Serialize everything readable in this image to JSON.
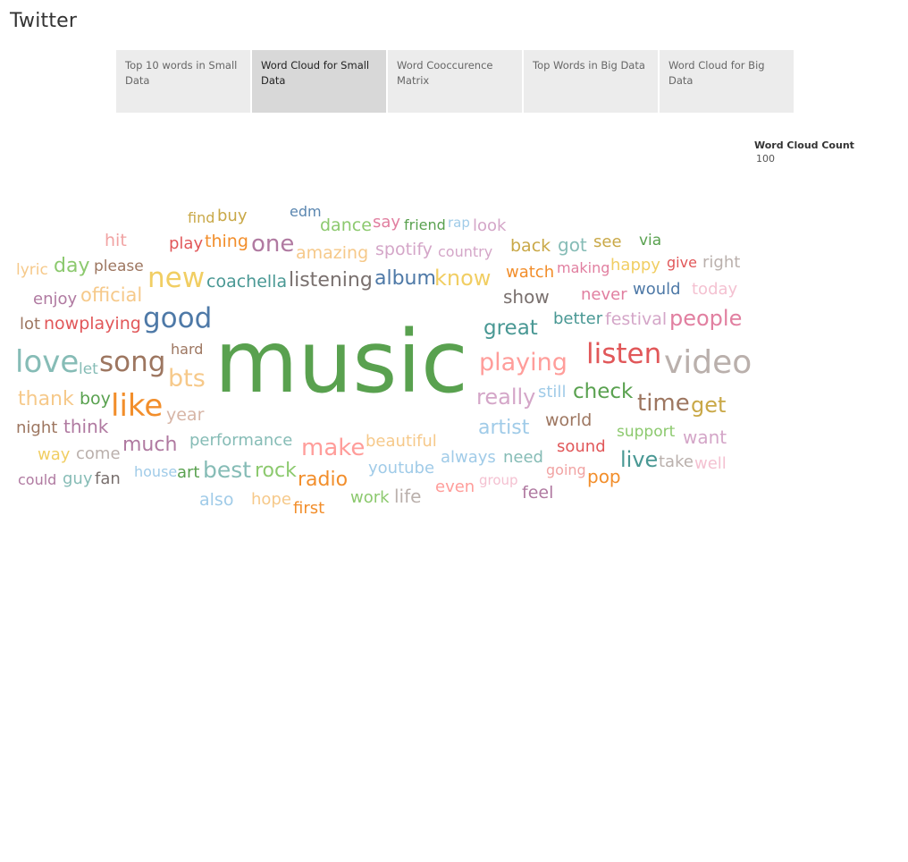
{
  "title": "Twitter",
  "tabs": [
    {
      "label": "Top 10 words in Small Data",
      "active": false
    },
    {
      "label": "Word Cloud for Small Data",
      "active": true
    },
    {
      "label": "Word Cooccurence Matrix",
      "active": false
    },
    {
      "label": "Top Words in Big Data",
      "active": false
    },
    {
      "label": "Word Cloud for Big Data",
      "active": false
    }
  ],
  "legend": {
    "title": "Word Cloud Count",
    "value": "100"
  },
  "words": [
    {
      "text": "find",
      "color": "#c9a847"
    },
    {
      "text": "buy",
      "color": "#c9a847"
    },
    {
      "text": "edm",
      "color": "#5a86b0"
    },
    {
      "text": "dance",
      "color": "#8cc96e"
    },
    {
      "text": "say",
      "color": "#e17fa0"
    },
    {
      "text": "friend",
      "color": "#59a14f"
    },
    {
      "text": "rap",
      "color": "#a0cbe8"
    },
    {
      "text": "look",
      "color": "#d4a6c8"
    },
    {
      "text": "hit",
      "color": "#f1a3a3"
    },
    {
      "text": "play",
      "color": "#e15759"
    },
    {
      "text": "thing",
      "color": "#f28e2b"
    },
    {
      "text": "one",
      "color": "#b07aa1"
    },
    {
      "text": "amazing",
      "color": "#f6c98a"
    },
    {
      "text": "spotify",
      "color": "#d4a6c8"
    },
    {
      "text": "country",
      "color": "#d4a6c8"
    },
    {
      "text": "back",
      "color": "#c9a847"
    },
    {
      "text": "got",
      "color": "#86bcb6"
    },
    {
      "text": "see",
      "color": "#c9a847"
    },
    {
      "text": "via",
      "color": "#59a14f"
    },
    {
      "text": "lyric",
      "color": "#f6c98a"
    },
    {
      "text": "day",
      "color": "#8cc96e"
    },
    {
      "text": "please",
      "color": "#9d7660"
    },
    {
      "text": "new",
      "color": "#f1ce63"
    },
    {
      "text": "coachella",
      "color": "#499894"
    },
    {
      "text": "listening",
      "color": "#79706e"
    },
    {
      "text": "album",
      "color": "#4e79a7"
    },
    {
      "text": "know",
      "color": "#f1ce63"
    },
    {
      "text": "watch",
      "color": "#f28e2b"
    },
    {
      "text": "making",
      "color": "#e17fa0"
    },
    {
      "text": "happy",
      "color": "#f1ce63"
    },
    {
      "text": "give",
      "color": "#e15759"
    },
    {
      "text": "right",
      "color": "#bab0ac"
    },
    {
      "text": "enjoy",
      "color": "#b07aa1"
    },
    {
      "text": "official",
      "color": "#f6c98a"
    },
    {
      "text": "show",
      "color": "#79706e"
    },
    {
      "text": "never",
      "color": "#e17fa0"
    },
    {
      "text": "would",
      "color": "#4e79a7"
    },
    {
      "text": "today",
      "color": "#f4c1d1"
    },
    {
      "text": "lot",
      "color": "#9d7660"
    },
    {
      "text": "nowplaying",
      "color": "#e15759"
    },
    {
      "text": "good",
      "color": "#4e79a7"
    },
    {
      "text": "great",
      "color": "#499894"
    },
    {
      "text": "better",
      "color": "#499894"
    },
    {
      "text": "festival",
      "color": "#d4a6c8"
    },
    {
      "text": "people",
      "color": "#e17fa0"
    },
    {
      "text": "hard",
      "color": "#9d7660"
    },
    {
      "text": "love",
      "color": "#86bcb6"
    },
    {
      "text": "let",
      "color": "#86bcb6"
    },
    {
      "text": "song",
      "color": "#9d7660"
    },
    {
      "text": "music",
      "color": "#59a14f"
    },
    {
      "text": "playing",
      "color": "#ff9d9a"
    },
    {
      "text": "listen",
      "color": "#e15759"
    },
    {
      "text": "video",
      "color": "#bab0ac"
    },
    {
      "text": "bts",
      "color": "#f6c98a"
    },
    {
      "text": "thank",
      "color": "#f6c98a"
    },
    {
      "text": "boy",
      "color": "#59a14f"
    },
    {
      "text": "like",
      "color": "#f28e2b"
    },
    {
      "text": "year",
      "color": "#d7b5a6"
    },
    {
      "text": "really",
      "color": "#d4a6c8"
    },
    {
      "text": "still",
      "color": "#a0cbe8"
    },
    {
      "text": "check",
      "color": "#59a14f"
    },
    {
      "text": "time",
      "color": "#9d7660"
    },
    {
      "text": "get",
      "color": "#c9a847"
    },
    {
      "text": "night",
      "color": "#9d7660"
    },
    {
      "text": "think",
      "color": "#b07aa1"
    },
    {
      "text": "artist",
      "color": "#a0cbe8"
    },
    {
      "text": "world",
      "color": "#9d7660"
    },
    {
      "text": "much",
      "color": "#b07aa1"
    },
    {
      "text": "performance",
      "color": "#86bcb6"
    },
    {
      "text": "make",
      "color": "#ff9d9a"
    },
    {
      "text": "beautiful",
      "color": "#f6c98a"
    },
    {
      "text": "sound",
      "color": "#e15759"
    },
    {
      "text": "support",
      "color": "#8cc96e"
    },
    {
      "text": "want",
      "color": "#d4a6c8"
    },
    {
      "text": "way",
      "color": "#f1ce63"
    },
    {
      "text": "come",
      "color": "#bab0ac"
    },
    {
      "text": "house",
      "color": "#a0cbe8"
    },
    {
      "text": "art",
      "color": "#59a14f"
    },
    {
      "text": "best",
      "color": "#86bcb6"
    },
    {
      "text": "rock",
      "color": "#8cc96e"
    },
    {
      "text": "radio",
      "color": "#f28e2b"
    },
    {
      "text": "youtube",
      "color": "#a0cbe8"
    },
    {
      "text": "always",
      "color": "#a0cbe8"
    },
    {
      "text": "need",
      "color": "#86bcb6"
    },
    {
      "text": "going",
      "color": "#f1a3a3"
    },
    {
      "text": "live",
      "color": "#499894"
    },
    {
      "text": "take",
      "color": "#bab0ac"
    },
    {
      "text": "well",
      "color": "#f4c1d1"
    },
    {
      "text": "could",
      "color": "#b07aa1"
    },
    {
      "text": "guy",
      "color": "#86bcb6"
    },
    {
      "text": "fan",
      "color": "#79706e"
    },
    {
      "text": "pop",
      "color": "#f28e2b"
    },
    {
      "text": "group",
      "color": "#f4c1d1"
    },
    {
      "text": "also",
      "color": "#a0cbe8"
    },
    {
      "text": "hope",
      "color": "#f6c98a"
    },
    {
      "text": "work",
      "color": "#8cc96e"
    },
    {
      "text": "life",
      "color": "#bab0ac"
    },
    {
      "text": "even",
      "color": "#ff9d9a"
    },
    {
      "text": "feel",
      "color": "#b07aa1"
    },
    {
      "text": "first",
      "color": "#f28e2b"
    }
  ]
}
